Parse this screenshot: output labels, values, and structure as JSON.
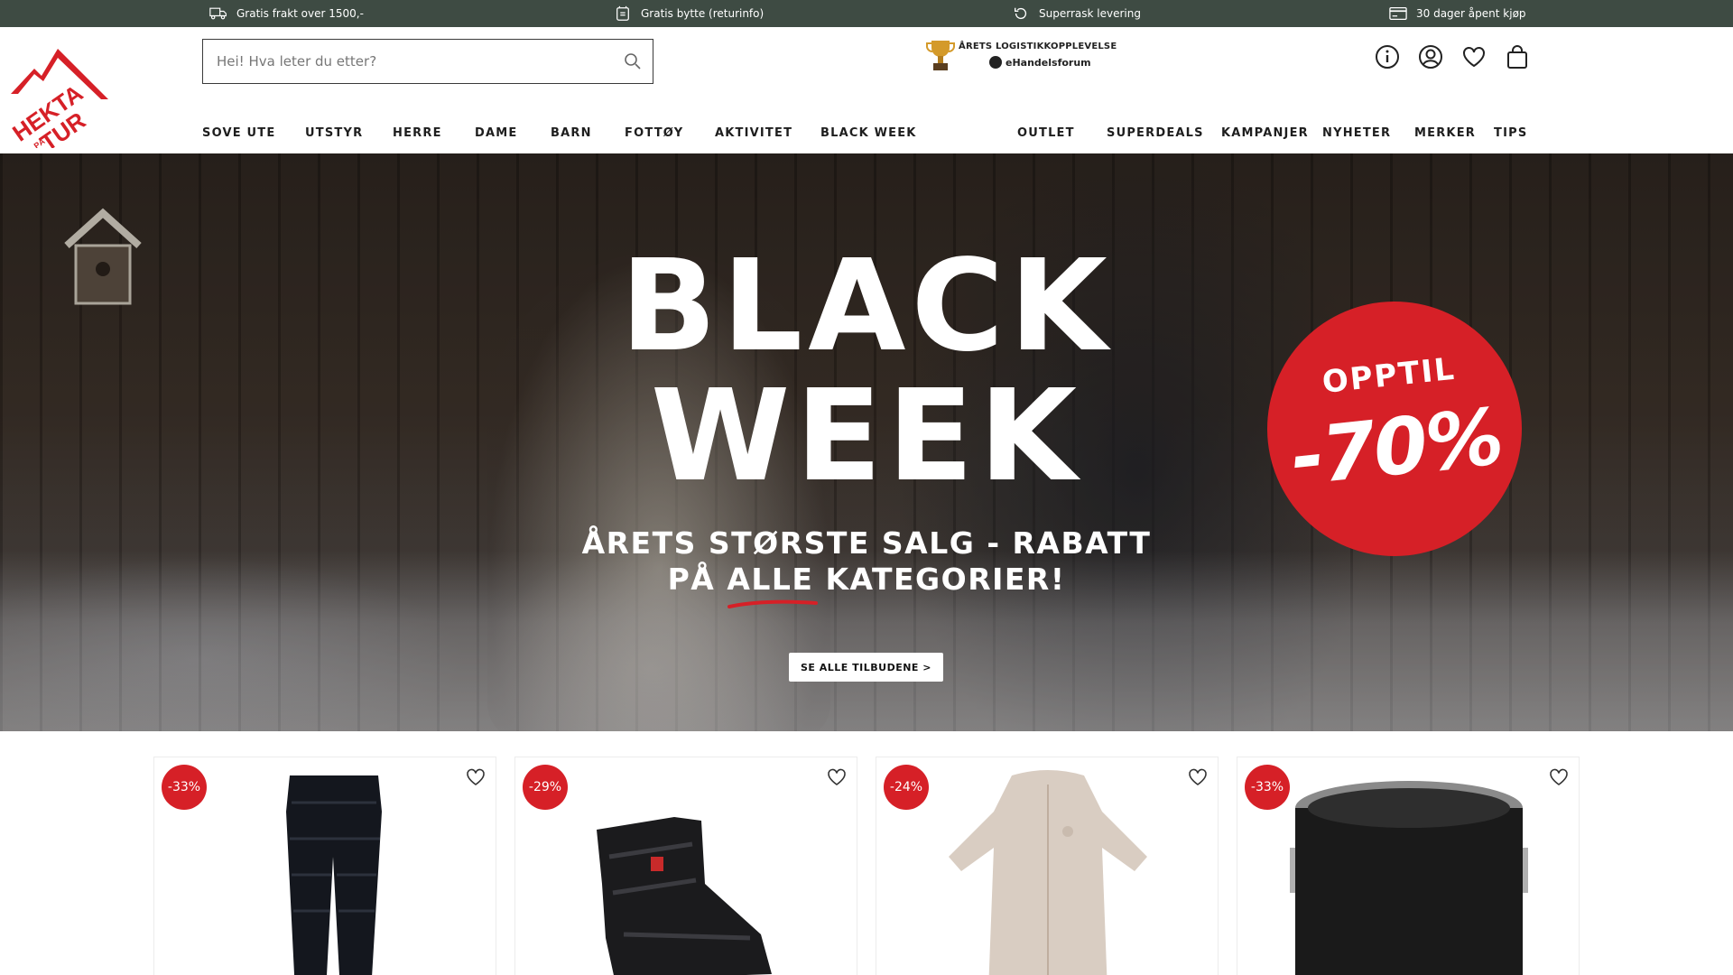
{
  "topbar": {
    "usps": [
      {
        "label": "Gratis frakt over 1500,-",
        "icon": "truck-icon"
      },
      {
        "label": "Gratis bytte (returinfo)",
        "icon": "exchange-icon"
      },
      {
        "label": "Superrask levering",
        "icon": "refresh-icon"
      },
      {
        "label": "30 dager åpent kjøp",
        "icon": "card-icon"
      }
    ]
  },
  "header": {
    "logo_text_1": "HEKTA",
    "logo_text_2": "TUR",
    "logo_text_amp": "PÅ",
    "search": {
      "placeholder": "Hei! Hva leter du etter?"
    },
    "award": {
      "title": "ÅRETS LOGISTIKKOPPLEVELSE",
      "brand": "eHandelsforum"
    },
    "icons": [
      "info-icon",
      "account-icon",
      "heart-icon",
      "bag-icon"
    ]
  },
  "nav": {
    "items": [
      "SOVE UTE",
      "UTSTYR",
      "HERRE",
      "DAME",
      "BARN",
      "FOTTØY",
      "AKTIVITET",
      "BLACK WEEK",
      "OUTLET",
      "SUPERDEALS",
      "KAMPANJER",
      "NYHETER",
      "MERKER",
      "TIPS"
    ]
  },
  "hero": {
    "headline_1": "BLACK",
    "headline_2": "WEEK",
    "subline_1": "ÅRETS STØRSTE SALG - RABATT",
    "subline_2": "PÅ ALLE KATEGORIER!",
    "cta": "SE ALLE TILBUDENE >",
    "badge_1": "OPPTIL",
    "badge_2": "-70%"
  },
  "products": [
    {
      "discount": "-33%",
      "kind": "down-pants"
    },
    {
      "discount": "-29%",
      "kind": "boot"
    },
    {
      "discount": "-24%",
      "kind": "baby-suit"
    },
    {
      "discount": "-33%",
      "kind": "ice-bucket"
    }
  ],
  "colors": {
    "topbar": "#3e4b43",
    "accent_red": "#d62027",
    "text": "#1a1a1a"
  }
}
